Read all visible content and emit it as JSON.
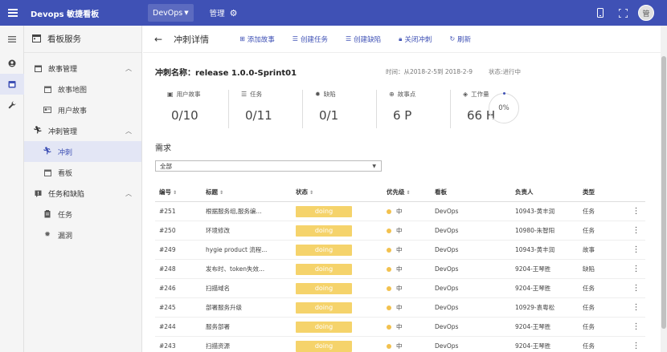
{
  "app": {
    "title": "Devops 敏捷看板",
    "project": "DevOps",
    "manage": "管理",
    "avatar_text": "管"
  },
  "sidebar": {
    "header": "看板服务",
    "groups": [
      {
        "label": "故事管理",
        "items": [
          {
            "label": "故事地图"
          },
          {
            "label": "用户故事"
          }
        ]
      },
      {
        "label": "冲刺管理",
        "items": [
          {
            "label": "冲刺"
          },
          {
            "label": "看板"
          }
        ]
      },
      {
        "label": "任务和缺陷",
        "items": [
          {
            "label": "任务"
          },
          {
            "label": "漏洞"
          }
        ]
      }
    ]
  },
  "page": {
    "title": "冲刺详情",
    "actions": [
      "添加故事",
      "创建任务",
      "创建缺陷",
      "关闭冲刺",
      "刷新"
    ],
    "sprint_label": "冲刺名称：release 1.0.0-Sprint01",
    "time": "时间：从2018-2-5到 2018-2-9",
    "status": "状态:进行中",
    "stats": [
      {
        "label": "用户故事",
        "value": "0/10"
      },
      {
        "label": "任务",
        "value": "0/11"
      },
      {
        "label": "缺陷",
        "value": "0/1"
      },
      {
        "label": "故事点",
        "value": "6 P"
      },
      {
        "label": "工作量",
        "value": "66 H"
      }
    ],
    "progress": "0%",
    "progress_value": 0,
    "section": "需求",
    "filter": "全部"
  },
  "table": {
    "headers": [
      "编号",
      "标题",
      "状态",
      "优先级",
      "看板",
      "负责人",
      "类型"
    ],
    "rows": [
      {
        "id": "#251",
        "title": "根据服务组,服务编...",
        "status": "doing",
        "priority": "中",
        "board": "DevOps",
        "owner": "10943-黄丰润",
        "type": "任务"
      },
      {
        "id": "#250",
        "title": "环境修改",
        "status": "doing",
        "priority": "中",
        "board": "DevOps",
        "owner": "10980-朱智阳",
        "type": "任务"
      },
      {
        "id": "#249",
        "title": "hygie product 流程...",
        "status": "doing",
        "priority": "中",
        "board": "DevOps",
        "owner": "10943-黄丰润",
        "type": "故事"
      },
      {
        "id": "#248",
        "title": "发布时、token失效...",
        "status": "doing",
        "priority": "中",
        "board": "DevOps",
        "owner": "9204-王琴胜",
        "type": "缺陷"
      },
      {
        "id": "#246",
        "title": "扫描域名",
        "status": "doing",
        "priority": "中",
        "board": "DevOps",
        "owner": "9204-王琴胜",
        "type": "任务"
      },
      {
        "id": "#245",
        "title": "部署服务升级",
        "status": "doing",
        "priority": "中",
        "board": "DevOps",
        "owner": "10929-袁粤松",
        "type": "任务"
      },
      {
        "id": "#244",
        "title": "服务部署",
        "status": "doing",
        "priority": "中",
        "board": "DevOps",
        "owner": "9204-王琴胜",
        "type": "任务"
      },
      {
        "id": "#243",
        "title": "扫描资源",
        "status": "doing",
        "priority": "中",
        "board": "DevOps",
        "owner": "9204-王琴胜",
        "type": "任务"
      }
    ]
  },
  "colors": {
    "primary": "#3f51b5",
    "doing": "#f5d36b",
    "priority_mid": "#f2c14e"
  }
}
